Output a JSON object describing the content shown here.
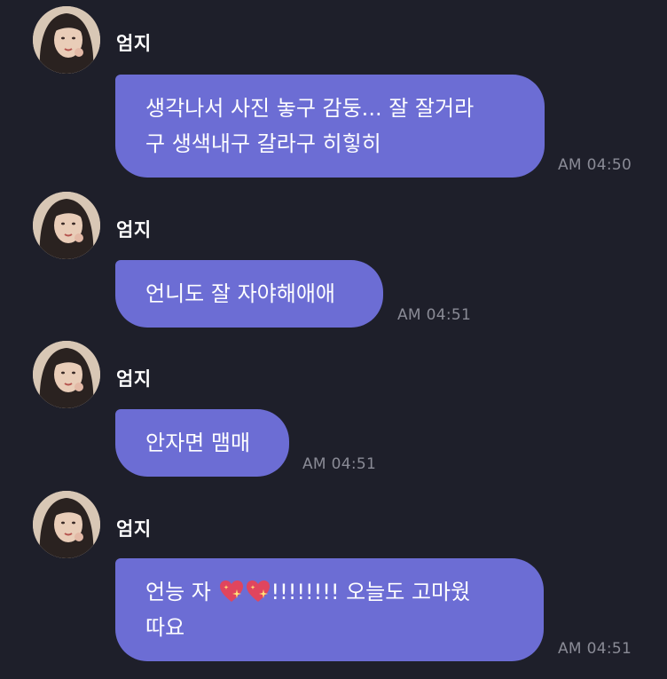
{
  "messages": [
    {
      "sender": "엄지",
      "lines": [
        "생각나서 사진 놓구 감둥... 잘 잘거라",
        "구 생색내구 갈라구 히힣히"
      ],
      "time": "AM 04:50"
    },
    {
      "sender": "엄지",
      "lines": [
        "언니도 잘 자야해애애"
      ],
      "time": "AM 04:51"
    },
    {
      "sender": "엄지",
      "lines": [
        "안자면 맴매"
      ],
      "time": "AM 04:51"
    },
    {
      "sender": "엄지",
      "line1_before": "언능 자 ",
      "line1_after": "!!!!!!!! 오늘도 고마웠",
      "line2": "따요",
      "emoji": "sparkling-heart-icon",
      "time": "AM 04:51"
    }
  ],
  "colors": {
    "background": "#1e1f2a",
    "bubble": "#6c6dd4",
    "time": "#8a8b96"
  }
}
